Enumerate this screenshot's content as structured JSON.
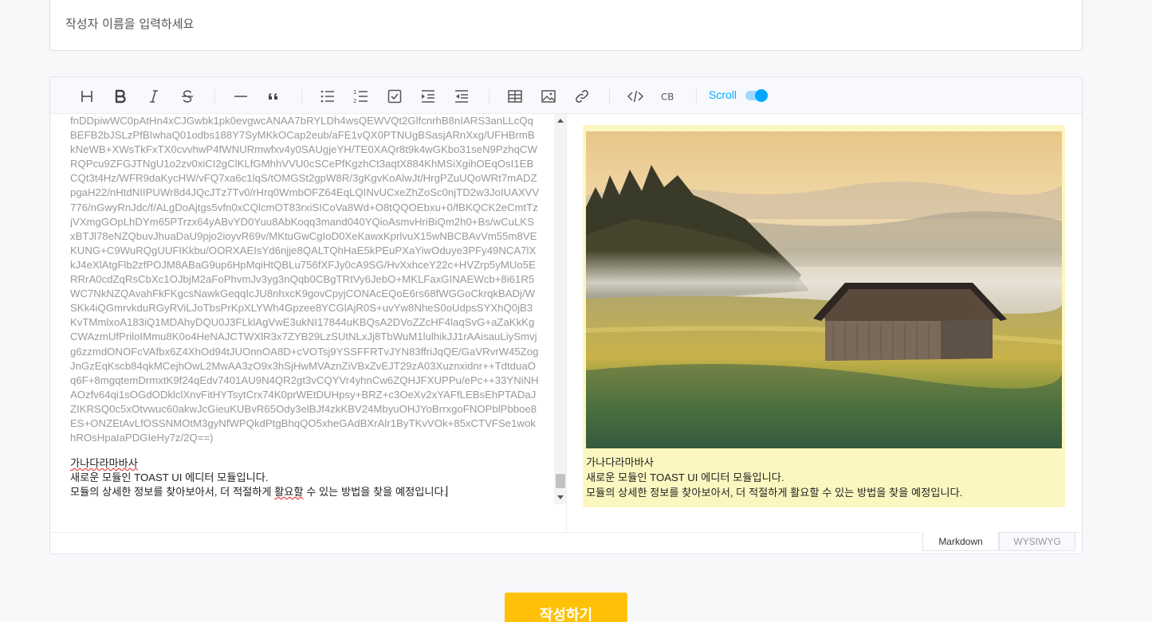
{
  "author": {
    "placeholder": "작성자 이름을 입력하세요"
  },
  "toolbar": {
    "scroll_label": "Scroll",
    "scroll_enabled": true,
    "buttons": [
      "heading-icon",
      "bold-icon",
      "italic-icon",
      "strike-icon",
      "hr-icon",
      "quote-icon",
      "bullet-list-icon",
      "ordered-list-icon",
      "task-list-icon",
      "indent-icon",
      "outdent-icon",
      "table-icon",
      "image-icon",
      "link-icon",
      "code-icon",
      "codeblock-icon"
    ]
  },
  "markdown": {
    "base64_lines": [
      "fnDDpiwWC0pAtHn4xCJGwbk1pk0evgwcANAA7bRYLDh4wsQEWVQt2GlfcnrhB8nIARS3anLLcQq",
      "BEFB2bJSLzPfBIwhaQ01odbs188Y7SyMKkOCap2eub/aFE1vQX0PTNUgBSasjARnXxg/UFHBrmB",
      "kNeWB+XWsTkFxTX0cvvhwP4fWNURmwfxv4y0SAUgjeYH/TE0XAQr8t9k4wGKbo31seN9PzhqCW",
      "RQPcu9ZFGJTNgU1o2zv0xiCI2gClKLfGMhhVVU0cSCePfKgzhCt3aqtX884KhMSiXgihOEqOsI1EB",
      "CQt3t4Hz/WFR9daKycHW/vFQ7xa6c1lqS/tOMGSt2gpW8R/3gKgvKoAlwJt/HrgPZuUQoWRt7mADZ",
      "pgaH22/nHtdNIIPUWr8d4JQcJTz7Tv0/rHrq0WmbOFZ64EqLQINvUCxeZhZoSc0njTD2w3JoIUAXVV",
      "776/nGwyRnJdc/f/ALgDoAjtgs5vfn0xCQlcmOT83rxiSICoVa8Wd+O8tQQOEbxu+0/fBKQCK2eCmtTz",
      "jVXmgGOpLhDYm65PTrzx64yABvYD0Yuu8AbKoqq3mand040YQioAsmvHriBiQm2h0+Bs/wCuLKS",
      "xBTJl78eNZQbuvJhuaDaU9pjo2ioyvR69v/MKtuGwCgIoD0XeKawxKprlvuX15wNBCBAvVm55m8VE",
      "KUNG+C9WuRQgUUFIKkbu/OORXAEIsYd6njje8QALTQhHaE5kPEuPXaYiwOduye3PFy49NCA7lX",
      "kJ4eXlAtgFlb2zfPOJM8ABaG9up6HpMqiHtQBLu756fXFJy0cA9SG/HvXxhceY22c+HVZrp5yMUo5E",
      "RRrA0cdZqRsCbXc1OJbjM2aFoPhvmJv3yg3nQqb0CBgTRtVy6JebO+MKLFaxGINAEWcb+8i61R5",
      "WC7NkNZQAvahFkFKgcsNawkGeqqIcJU8nhxcK9govCpyjCONAcEQoE6rs68fWGGoCkrqkBADj/W",
      "SKk4iQGmrvkduRGyRViLJoTbsPrKpXLYWh4Gpzee8YCGlAjR0S+uvYw8NheS0oUdpsSYXhQ0jB3",
      "KvTMmlxoA183iQ1MDAhyDQU0J3FLklAgVwE3ukNI17844uKBQsA2DVoZZcHF4laqSvG+aZaKkKg",
      "CWAzmUfPriloIMmu8K0o4HeNAJCTWXlR3x7ZYB29LzSUtNLxJj8TbWuM1lulhikJJ1rAAisauLiySmvj",
      "g6zzmdONOFcVAfbx6Z4XhOd94tJUOnnOA8D+cVOTsj9YSSFFRTvJYN83ffriJqQE/GaVRvrW45Zog",
      "JnGzEqKscb84qkMCejhOwL2MwAA3zO9x3hSjHwMVAznZiVBxZvEJT29zA03Xuznxidnr++TdtduaO",
      "q6F+8mgqtemDrmxtK9f24qEdv7401AU9N4QR2gt3vCQYVr4yhnCw6ZQHJFXUPPu/ePc++33YNiNH",
      "AOzfv64qi1sOGdODklclXnvFitHYTsytCrx74K0prWEtDUHpsy+BRZ+c3OeXv2xYAFfLEBsEhPTADaJ",
      "ZIKRSQ0c5xOtvwuc60akwJcGieuKUBvR65Ody3elBJf4zkKBV24MbyuOHJYoBrrxgoFNOPblPbboe8",
      "ES+ONZEtAvLfOSSNMOtM3gyNfWPQkdPtgBhqQO5xheGAdBXrAlr1ByTKvVOk+85xCTVFSe1wok",
      "hROsHpaIaPDGIeHy7z/2Q==)"
    ],
    "line1": "가나다라마바사",
    "line2": "새로운 모듈인 TOAST UI 에디터 모듈입니다.",
    "line3_a": "모듈의 상세한 정보를 찾아보아서, 더 적절하게 ",
    "line3_b": "활요할",
    "line3_c": " 수 있는 방법을 찾을 예정입니다."
  },
  "preview": {
    "line1": "가나다라마바사",
    "line2": "새로운 모듈인 TOAST UI 에디터 모듈입니다.",
    "line3": "모듈의 상세한 정보를 찾아보아서, 더 적절하게 활요할 수 있는 방법을 찾을 예정입니다."
  },
  "mode_tabs": {
    "markdown": "Markdown",
    "wysiwyg": "WYSIWYG",
    "active": "Markdown"
  },
  "submit": {
    "label": "작성하기"
  },
  "colors": {
    "accent": "#00a9ff",
    "submit": "#ffc107",
    "preview_highlight": "#fcf7c0"
  }
}
